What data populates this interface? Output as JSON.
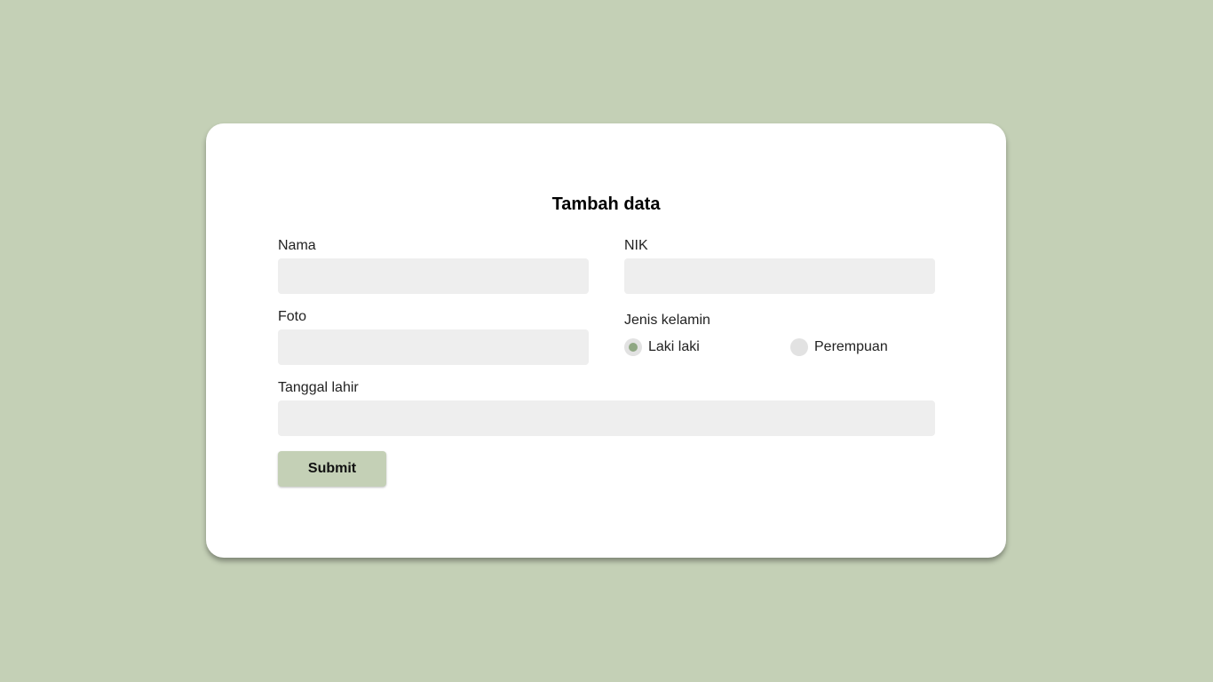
{
  "form": {
    "title": "Tambah data",
    "nama": {
      "label": "Nama",
      "value": "",
      "placeholder": ""
    },
    "nik": {
      "label": "NIK",
      "value": "",
      "placeholder": ""
    },
    "foto": {
      "label": "Foto",
      "value": "",
      "placeholder": ""
    },
    "jenis_kelamin": {
      "label": "Jenis kelamin",
      "options": [
        {
          "label": "Laki laki",
          "checked": true
        },
        {
          "label": "Perempuan",
          "checked": false
        }
      ]
    },
    "tanggal_lahir": {
      "label": "Tanggal lahir",
      "value": "",
      "placeholder": ""
    },
    "submit_label": "Submit"
  },
  "colors": {
    "background": "#c4d0b6",
    "card": "#ffffff",
    "field": "#eeeeee",
    "button": "#c4d0b6",
    "radio_checked": "#8fa783",
    "radio_unchecked": "#e2e2e2"
  }
}
